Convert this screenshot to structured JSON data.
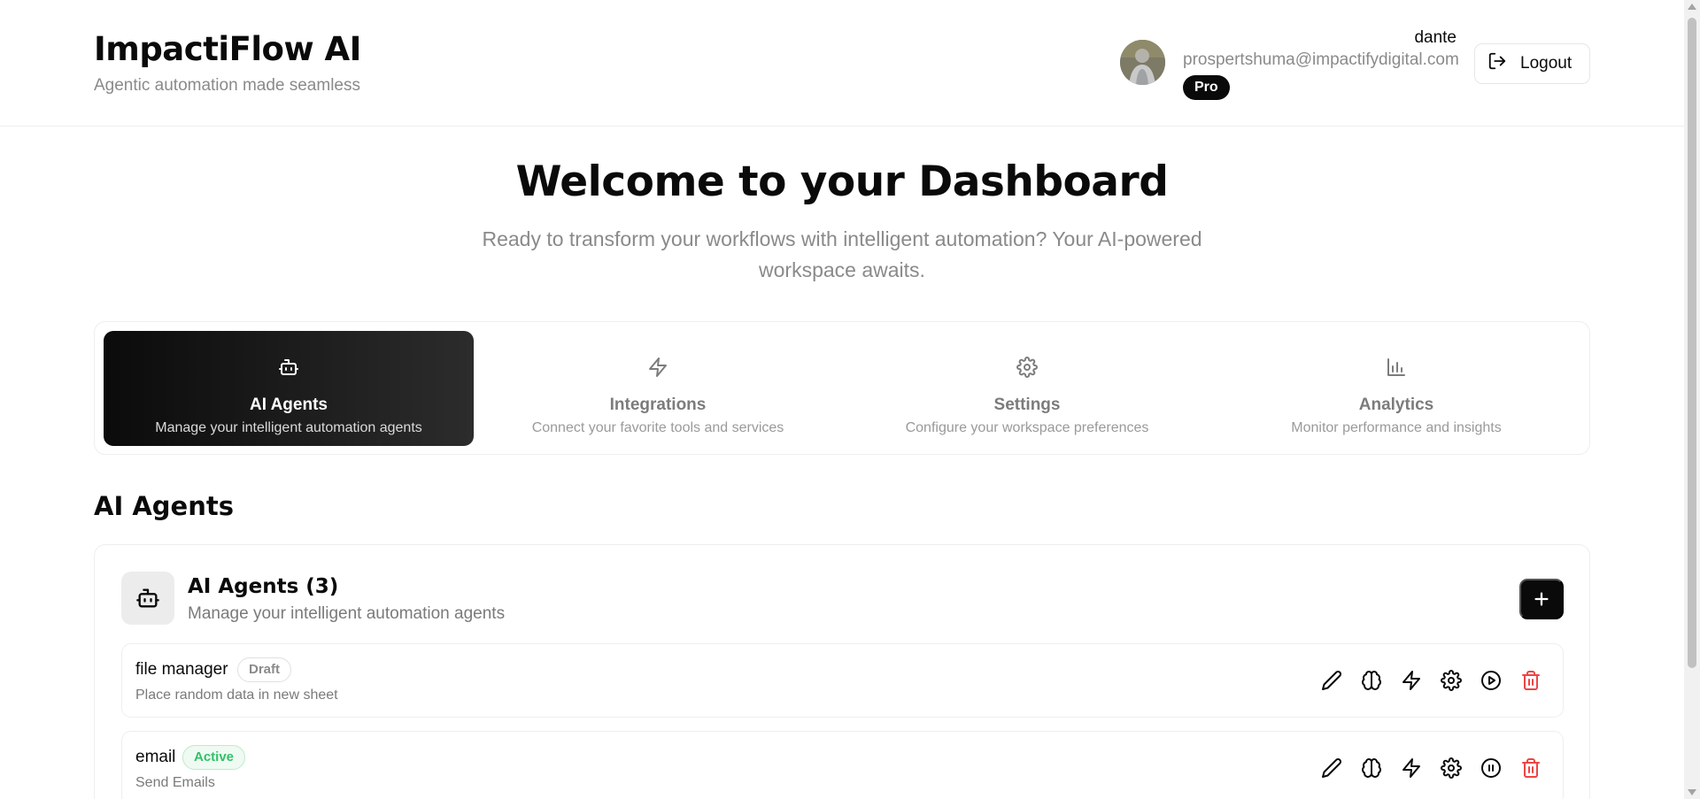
{
  "brand": {
    "title": "ImpactiFlow AI",
    "subtitle": "Agentic automation made seamless"
  },
  "user": {
    "name": "dante",
    "email": "prospertshuma@impactifydigital.com",
    "plan": "Pro",
    "logout_label": "Logout"
  },
  "hero": {
    "title": "Welcome to your Dashboard",
    "subtitle": "Ready to transform your workflows with intelligent automation? Your AI-powered workspace awaits."
  },
  "tabs": [
    {
      "label": "AI Agents",
      "description": "Manage your intelligent automation agents",
      "icon": "bot-icon",
      "active": true
    },
    {
      "label": "Integrations",
      "description": "Connect your favorite tools and services",
      "icon": "zap-icon",
      "active": false
    },
    {
      "label": "Settings",
      "description": "Configure your workspace preferences",
      "icon": "gear-icon",
      "active": false
    },
    {
      "label": "Analytics",
      "description": "Monitor performance and insights",
      "icon": "bar-chart-icon",
      "active": false
    }
  ],
  "section": {
    "title": "AI Agents"
  },
  "agents_card": {
    "title": "AI Agents (3)",
    "subtitle": "Manage your intelligent automation agents",
    "add_icon": "plus-icon"
  },
  "agents": [
    {
      "name": "file manager",
      "status": "Draft",
      "description": "Place random data in new sheet",
      "run_action": "play-icon"
    },
    {
      "name": "email",
      "status": "Active",
      "description": "Send Emails",
      "run_action": "pause-icon"
    }
  ],
  "colors": {
    "primary": "#0a0a0a",
    "muted_text": "#8a8a8a",
    "active_green": "#34c06a",
    "delete_red": "#ef4444"
  }
}
